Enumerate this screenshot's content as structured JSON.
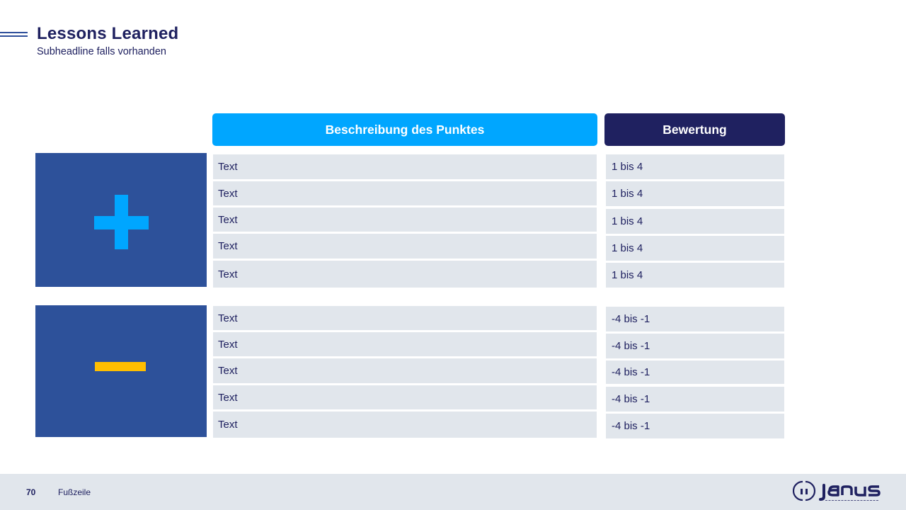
{
  "header": {
    "title": "Lessons Learned",
    "subtitle": "Subheadline falls vorhanden"
  },
  "table": {
    "col_description": "Beschreibung des Punktes",
    "col_rating": "Bewertung",
    "positive": {
      "icon": "plus-icon",
      "rows": [
        {
          "text": "Text",
          "rating": "1 bis 4"
        },
        {
          "text": "Text",
          "rating": "1 bis 4"
        },
        {
          "text": "Text",
          "rating": "1 bis 4"
        },
        {
          "text": "Text",
          "rating": "1 bis 4"
        },
        {
          "text": "Text",
          "rating": "1 bis 4"
        }
      ]
    },
    "negative": {
      "icon": "minus-icon",
      "rows": [
        {
          "text": "Text",
          "rating": "-4 bis -1"
        },
        {
          "text": "Text",
          "rating": "-4 bis -1"
        },
        {
          "text": "Text",
          "rating": "-4 bis -1"
        },
        {
          "text": "Text",
          "rating": "-4 bis -1"
        },
        {
          "text": "Text",
          "rating": "-4 bis -1"
        }
      ]
    }
  },
  "footer": {
    "page_number": "70",
    "text": "Fußzeile",
    "logo": "janus"
  },
  "colors": {
    "navy": "#1f2160",
    "light_blue": "#00a6ff",
    "block_blue": "#2d519a",
    "yellow": "#ffbe00",
    "cell_gray": "#e1e6ec"
  }
}
